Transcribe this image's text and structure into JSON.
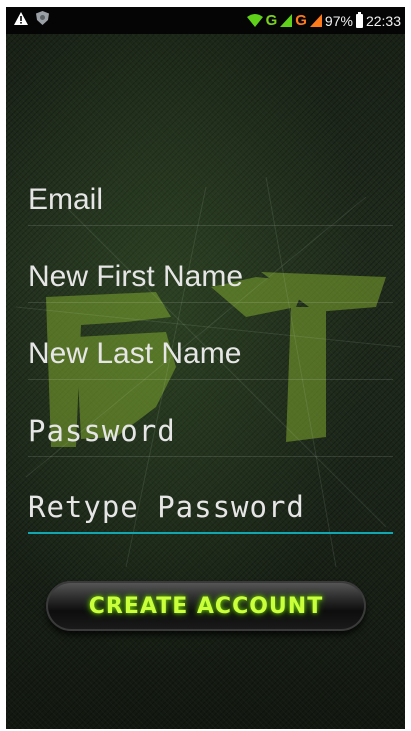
{
  "status_bar": {
    "network_g1": "G",
    "network_g2": "G",
    "battery": "97%",
    "time": "22:33"
  },
  "form": {
    "email_placeholder": "Email",
    "first_name_placeholder": "New First Name",
    "last_name_placeholder": "New Last Name",
    "password_placeholder": "Password",
    "retype_password_placeholder": "Retype Password",
    "create_button_label": "CREATE ACCOUNT"
  },
  "colors": {
    "accent_underline": "#11a6b0",
    "button_text": "#c9ff3b"
  }
}
